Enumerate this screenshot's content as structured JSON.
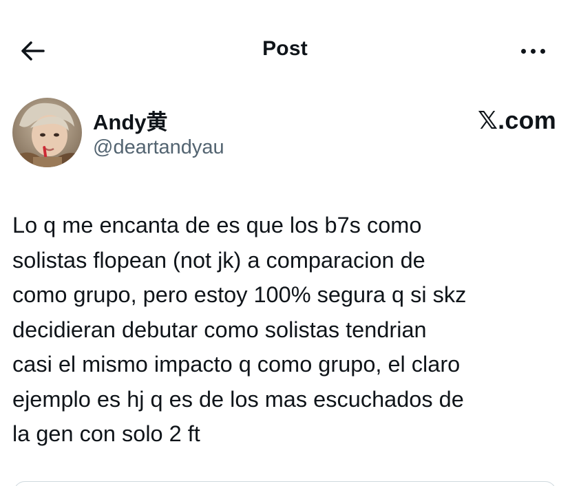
{
  "header": {
    "title": "Post"
  },
  "author": {
    "name": "Andy黄",
    "handle": "@deartandyau",
    "watermark": "𝕏.com"
  },
  "post": {
    "text": "Lo q me encanta de es que los b7s como\nsolistas flopean (not jk) a comparacion de\ncomo grupo, pero estoy 100% segura q si skz\ndecidieran debutar como solistas tendrian\ncasi el mismo impacto q como grupo, el claro\nejemplo es hj q es de los mas escuchados de\nla gen con solo 2 ft"
  },
  "icons": {
    "back": "arrow-left-icon",
    "more": "more-horizontal-icon"
  },
  "colors": {
    "text": "#0f1419",
    "secondary_text": "#536471",
    "border": "#cfd9de",
    "background": "#ffffff"
  }
}
